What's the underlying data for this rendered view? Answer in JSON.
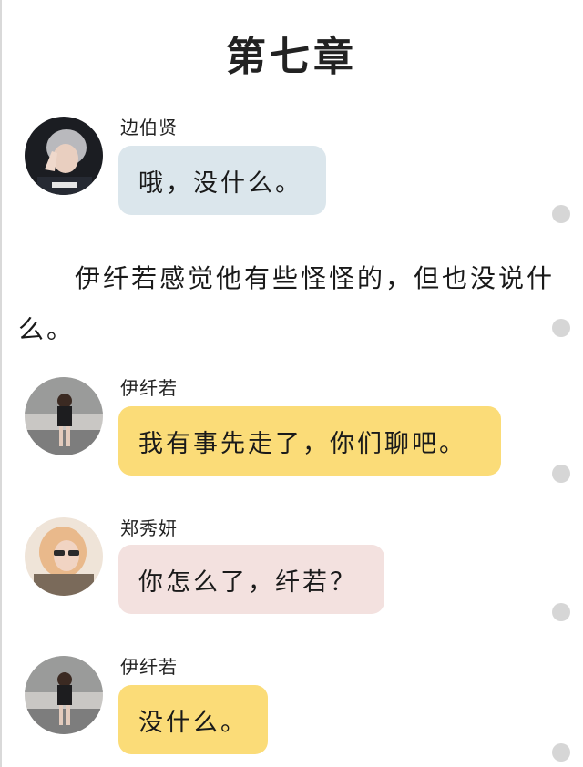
{
  "chapter": {
    "title": "第七章"
  },
  "colors": {
    "bubble_blue": "#dbe6ec",
    "bubble_yellow": "#fbdc78",
    "bubble_pink": "#f3e1df",
    "scroll_dot": "#d6d6d6"
  },
  "messages": [
    {
      "sender": "边伯贤",
      "text": "哦，没什么。",
      "avatar": "avatar-boy-peace-sign",
      "bubble": "blue"
    },
    {
      "sender": "伊纤若",
      "text": "我有事先走了，你们聊吧。",
      "avatar": "avatar-girl-street",
      "bubble": "yellow"
    },
    {
      "sender": "郑秀妍",
      "text": "你怎么了，纤若？",
      "avatar": "avatar-girl-sunglasses",
      "bubble": "pink"
    },
    {
      "sender": "伊纤若",
      "text": "没什么。",
      "avatar": "avatar-girl-street",
      "bubble": "yellow"
    }
  ],
  "narration": "伊纤若感觉他有些怪怪的，但也没说什么。"
}
